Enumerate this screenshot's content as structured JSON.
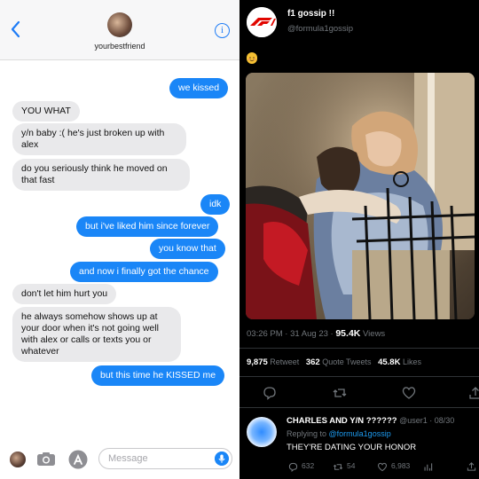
{
  "imessage": {
    "contact_name": "yourbestfriend",
    "info_label": "i",
    "messages": [
      {
        "side": "out",
        "text": "we kissed"
      },
      {
        "side": "in",
        "text": "YOU WHAT"
      },
      {
        "side": "in",
        "text": "y/n baby :( he's just broken up with alex"
      },
      {
        "side": "in",
        "text": "do you seriously think he moved on that fast"
      },
      {
        "side": "out",
        "text": "idk"
      },
      {
        "side": "out",
        "text": "but i've liked him since forever"
      },
      {
        "side": "out",
        "text": "you know that"
      },
      {
        "side": "out",
        "text": "and now i finally got the chance"
      },
      {
        "side": "in",
        "text": "don't let him hurt you"
      },
      {
        "side": "in",
        "text": "he always somehow shows up at your door when it's not going well with alex or calls or texts you or whatever"
      },
      {
        "side": "out",
        "text": "but this time he KISSED me"
      }
    ],
    "input_placeholder": "Message"
  },
  "tweet": {
    "display_name": "f1 gossip !!",
    "handle": "@formula1gossip",
    "emoji_icon": "blushing-face-emoji",
    "timestamp": "03:26 PM · 31 Aug 23 · ",
    "views_count": "95.4K",
    "views_label": " Views",
    "retweets_count": "9,875",
    "retweets_label": " Retweet",
    "quotes_count": "362",
    "quotes_label": " Quote Tweets",
    "likes_count": "45.8K",
    "likes_label": " Likes"
  },
  "reply": {
    "name": "CHARLES AND Y/N ??????",
    "handle_date": " @user1 · 08/30",
    "replying_prefix": "Replying to ",
    "replying_to": "@formula1gossip",
    "text": "THEY'RE DATING YOUR HONOR",
    "replies": "632",
    "retweets": "54",
    "likes": "6,983"
  },
  "colors": {
    "imessage_blue": "#1a86f7",
    "imessage_gray": "#e9e9eb",
    "twitter_link": "#1d9bf0",
    "twitter_muted": "#71767b",
    "f1_red": "#e10600"
  }
}
